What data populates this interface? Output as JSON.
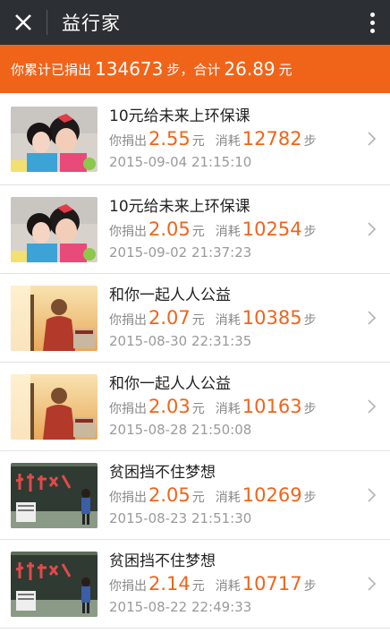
{
  "header": {
    "title": "益行家"
  },
  "summary": {
    "prefix": "你累计已捐出",
    "steps": "134673",
    "steps_unit": "步，合计",
    "amount": "26.89",
    "amount_unit": "元"
  },
  "labels": {
    "donated": "你捐出",
    "yuan": "元",
    "consumed": "消耗",
    "steps": "步"
  },
  "items": [
    {
      "title": "10元给未来上环保课",
      "amount": "2.55",
      "steps": "12782",
      "date": "2015-09-04 21:15:10",
      "image": "children-photo"
    },
    {
      "title": "10元给未来上环保课",
      "amount": "2.05",
      "steps": "10254",
      "date": "2015-09-02 21:37:23",
      "image": "children-photo"
    },
    {
      "title": "和你一起人人公益",
      "amount": "2.07",
      "steps": "10385",
      "date": "2015-08-30 22:31:35",
      "image": "sunset-person-photo"
    },
    {
      "title": "和你一起人人公益",
      "amount": "2.03",
      "steps": "10163",
      "date": "2015-08-28 21:50:08",
      "image": "sunset-person-photo"
    },
    {
      "title": "贫困挡不住梦想",
      "amount": "2.05",
      "steps": "10269",
      "date": "2015-08-23 21:51:30",
      "image": "blackboard-photo"
    },
    {
      "title": "贫困挡不住梦想",
      "amount": "2.14",
      "steps": "10717",
      "date": "2015-08-22 22:49:33",
      "image": "blackboard-photo"
    }
  ],
  "colors": {
    "accent": "#f0641a",
    "topbar": "#2c2f33"
  }
}
